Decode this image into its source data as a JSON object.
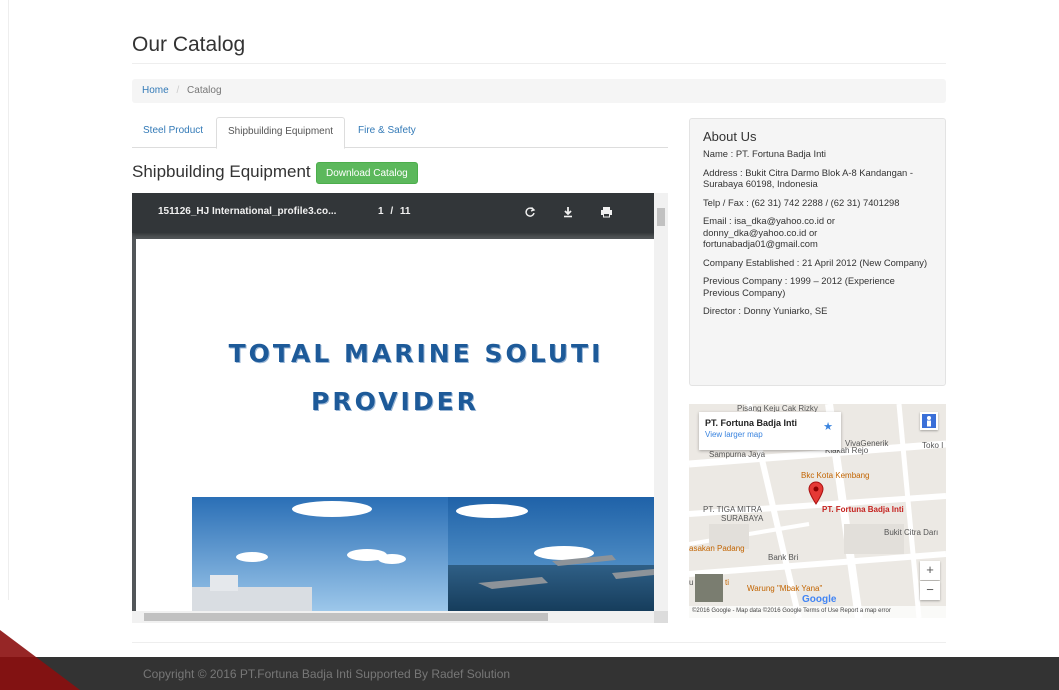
{
  "header": {
    "title": "Our Catalog"
  },
  "breadcrumb": {
    "home": "Home",
    "separator": "/",
    "current": "Catalog"
  },
  "tabs": [
    {
      "label": "Steel Product",
      "active": false
    },
    {
      "label": "Shipbuilding Equipment",
      "active": true
    },
    {
      "label": "Fire & Safety",
      "active": false
    }
  ],
  "section": {
    "title": "Shipbuilding Equipment",
    "download_label": "Download Catalog"
  },
  "viewer": {
    "filename": "151126_HJ International_profile3.co...",
    "page_current": "1",
    "page_separator": "/",
    "page_total": "11",
    "icons": [
      "rotate-icon",
      "download-icon",
      "print-icon"
    ],
    "doc_heading_line1": "TOTAL MARINE SOLUTI",
    "doc_heading_line2": "PROVIDER"
  },
  "about": {
    "title": "About Us",
    "lines": [
      "Name : PT. Fortuna Badja Inti",
      "Address : Bukit Citra Darmo Blok A-8 Kandangan - Surabaya 60198, Indonesia",
      "Telp / Fax : (62 31) 742 2288 / (62 31) 7401298",
      "Email : isa_dka@yahoo.co.id or donny_dka@yahoo.co.id or fortunabadja01@gmail.com",
      "Company Established : 21 April 2012 (New Company)",
      "Previous Company : 1999 – 2012 (Experience Previous Company)",
      "Director : Donny Yuniarko, SE"
    ]
  },
  "map": {
    "place_name": "PT. Fortuna Badja Inti",
    "view_larger": "View larger map",
    "labels": {
      "pisang": "Pisang Keju Cak Rizky",
      "viva": "VivaGenerik",
      "toko": "Toko I",
      "sampurna": "Sampurna Jaya",
      "klakah": "Klakah Rejo",
      "bkc": "Bkc Kota Kembang",
      "tiga1": "PT. TIGA MITRA",
      "tiga2": "SURABAYA",
      "fortuna": "PT. Fortuna Badja Inti",
      "bukit": "Bukit Citra Darı",
      "masakan": "asakan Padang",
      "bank": "Bank Bri",
      "warung": "Warung \"Mbak Yana\"",
      "u": "u",
      "ti": "ti"
    },
    "zoom_in": "+",
    "zoom_out": "−",
    "google": "Google",
    "attribution": "©2016 Google - Map data ©2016 Google    Terms of Use    Report a map error"
  },
  "footer": {
    "text": "Copyright © 2016 PT.Fortuna Badja Inti Supported By Radef Solution"
  },
  "colors": {
    "link": "#337ab7",
    "button": "#5cb85c",
    "footer_bg": "#333333",
    "heading_blue": "#1d5a99"
  }
}
